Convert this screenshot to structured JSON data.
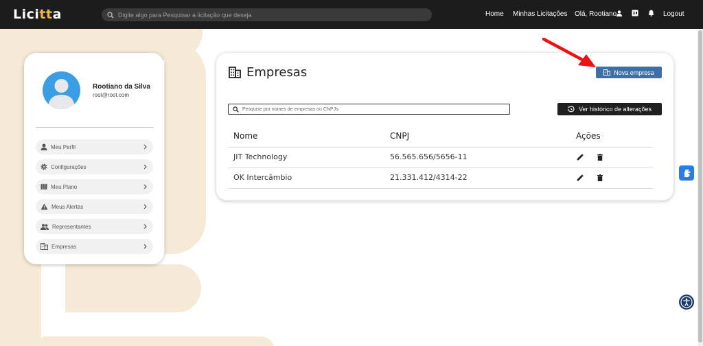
{
  "colors": {
    "navbar": "#1c1c1c",
    "logo_accent": "#f0b545",
    "background_shape": "#f6e9d6",
    "primary_button": "#3e6fa6",
    "dark_button": "#1f1f1f",
    "annotation_arrow": "#ee1111"
  },
  "navbar": {
    "logo_prefix": "Lici",
    "logo_accent": "tt",
    "logo_suffix": "a",
    "search_placeholder": "Digite algo para Pesquisar a licitação que deseja",
    "links": {
      "home": "Home",
      "minhas_licitacoes": "Minhas Licitações",
      "greeting": "Olá, Rootiano",
      "logout": "Logout"
    },
    "icons": [
      "search-icon",
      "user-icon",
      "id-card-icon",
      "bell-icon"
    ]
  },
  "profile": {
    "name": "Rootiano da Silva",
    "email": "root@root.com",
    "menu": [
      {
        "label": "Meu Perfil",
        "icon": "user-icon"
      },
      {
        "label": "Configurações",
        "icon": "gear-icon"
      },
      {
        "label": "Meu Plano",
        "icon": "map-icon"
      },
      {
        "label": "Meus Alertas",
        "icon": "warning-icon"
      },
      {
        "label": "Representantes",
        "icon": "people-icon"
      },
      {
        "label": "Empresas",
        "icon": "building-icon"
      }
    ]
  },
  "main": {
    "title": "Empresas",
    "new_button": "Nova empresa",
    "search_placeholder": "Pesquise por nomes de empresas ou CNPJs",
    "history_button": "Ver histórico de alterações",
    "table": {
      "columns": [
        "Nome",
        "CNPJ",
        "Ações"
      ],
      "rows": [
        {
          "nome": "JIT Technology",
          "cnpj": "56.565.656/5656-11"
        },
        {
          "nome": "OK Intercâmbio",
          "cnpj": "21.331.412/4314-22"
        }
      ]
    }
  }
}
